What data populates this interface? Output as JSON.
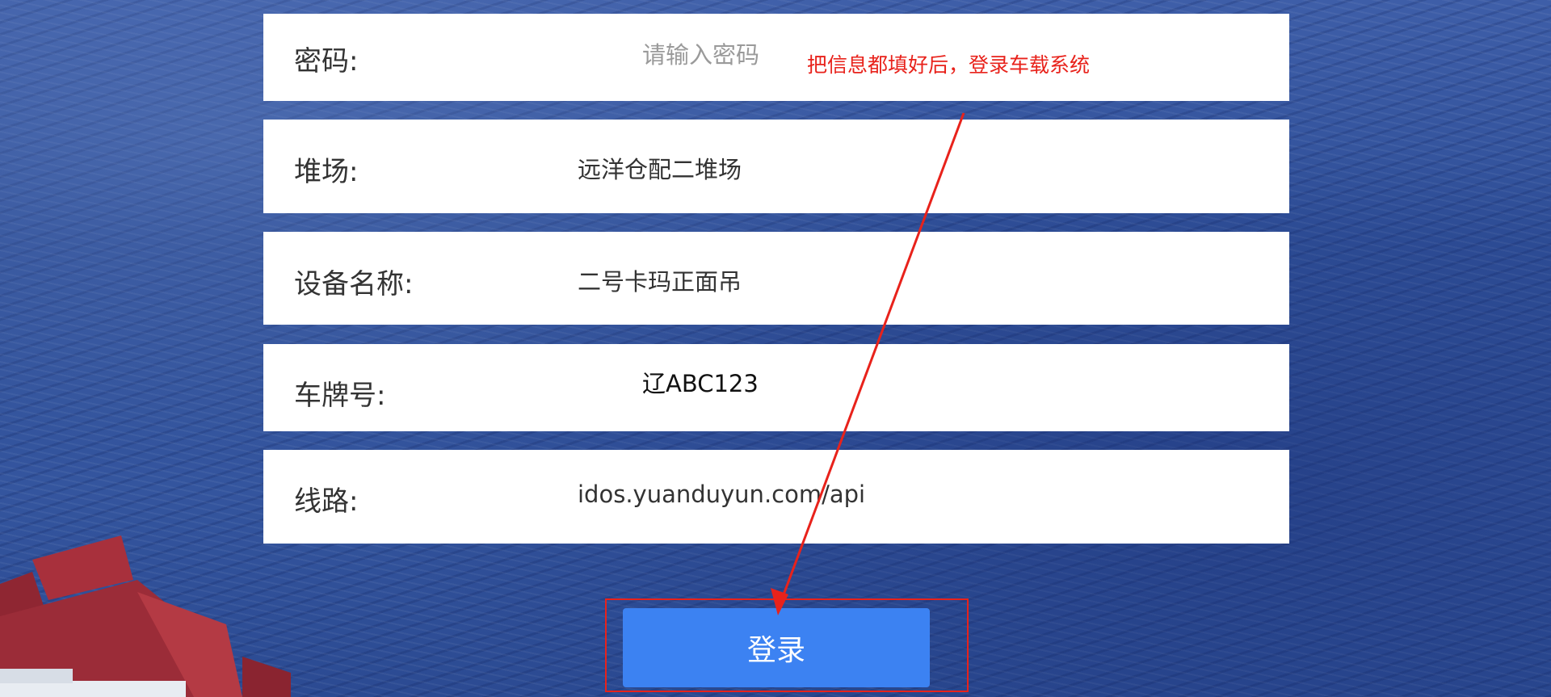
{
  "form": {
    "password": {
      "label": "密码:",
      "placeholder": "请输入密码"
    },
    "yard": {
      "label": "堆场:",
      "value": "远洋仓配二堆场"
    },
    "device": {
      "label": "设备名称:",
      "value": "二号卡玛正面吊"
    },
    "plate": {
      "label": "车牌号:",
      "value": "辽ABC123"
    },
    "route": {
      "label": "线路:",
      "value": "idos.yuanduyun.com/api"
    }
  },
  "login_button": {
    "label": "登录"
  },
  "annotation": {
    "text": "把信息都填好后，登录车载系统",
    "color": "#e8221b"
  },
  "colors": {
    "primary_button": "#3c82f2",
    "background_sea": "#2f4f98"
  }
}
